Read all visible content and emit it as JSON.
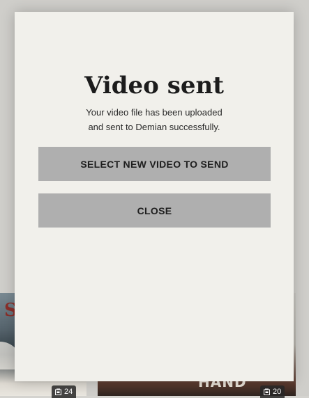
{
  "modal": {
    "title": "Video sent",
    "message_line1": "Your video file has been uploaded",
    "message_line2": "and sent to Demian successfully.",
    "select_button_label": "SELECT NEW VIDEO TO SEND",
    "close_button_label": "CLOSE"
  },
  "background": {
    "cards": [
      {
        "badge_count": "24",
        "badge_icon": "file-icon",
        "partial_text": "S"
      },
      {
        "badge_count": "20",
        "badge_icon": "file-icon",
        "partial_text": "HAND"
      }
    ]
  },
  "colors": {
    "modal_bg": "#f1f0eb",
    "button_bg": "#afafaf",
    "overlay": "#cfceca"
  }
}
